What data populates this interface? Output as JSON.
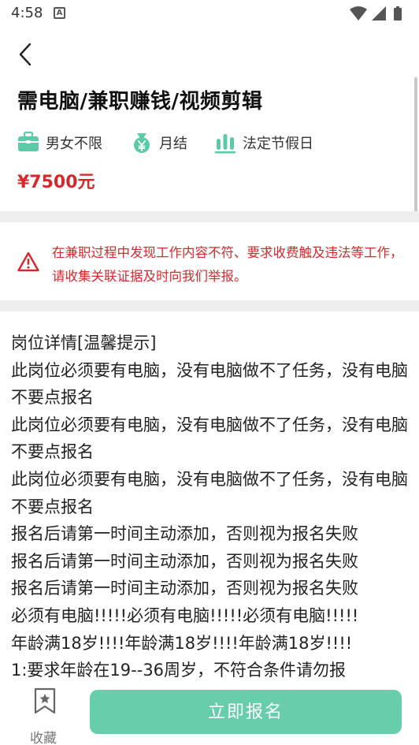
{
  "status_bar": {
    "time": "4:58",
    "notification_letter": "A"
  },
  "job": {
    "title": "需电脑/兼职赚钱/视频剪辑",
    "tags": [
      {
        "icon": "briefcase-icon",
        "label": "男女不限"
      },
      {
        "icon": "money-bag-icon",
        "label": "月结"
      },
      {
        "icon": "bars-icon",
        "label": "法定节假日"
      }
    ],
    "salary": "¥7500元"
  },
  "warning": {
    "icon": "warning-triangle-icon",
    "text": "在兼职过程中发现工作内容不符、要求收费触及违法等工作，请收集关联证据及时向我们举报。"
  },
  "detail": {
    "lines": [
      "岗位详情[温馨提示]",
      "此岗位必须要有电脑，没有电脑做不了任务，没有电脑不要点报名",
      "此岗位必须要有电脑，没有电脑做不了任务，没有电脑不要点报名",
      "此岗位必须要有电脑，没有电脑做不了任务，没有电脑不要点报名",
      "报名后请第一时间主动添加，否则视为报名失败",
      "报名后请第一时间主动添加，否则视为报名失败",
      "报名后请第一时间主动添加，否则视为报名失败",
      "必须有电脑!!!!!必须有电脑!!!!!必须有电脑!!!!!",
      "年龄满18岁!!!!年龄满18岁!!!!年龄满18岁!!!!",
      "1:要求年龄在19--36周岁，不符合条件请勿报"
    ]
  },
  "bottom_bar": {
    "favorite_label": "收藏",
    "apply_label": "立即报名"
  },
  "colors": {
    "accent": "#67cdab",
    "price": "#d7282b",
    "tag_icon": "#5cc9a7"
  }
}
